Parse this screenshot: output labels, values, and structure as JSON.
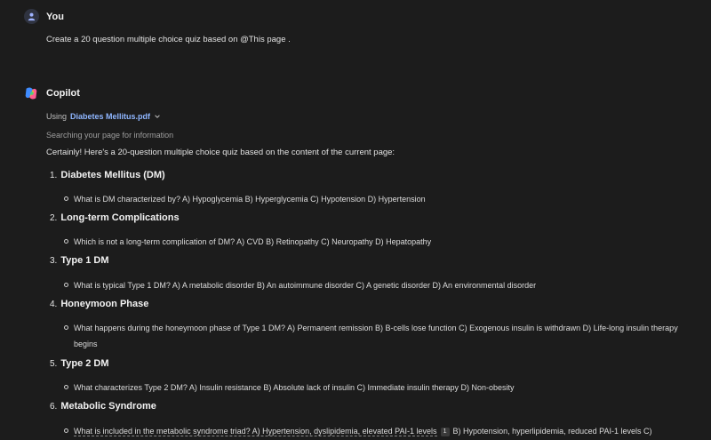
{
  "user": {
    "name": "You",
    "message": "Create a 20 question multiple choice quiz based on @This page ."
  },
  "copilot": {
    "name": "Copilot",
    "using_label": "Using",
    "file_name": "Diabetes Mellitus.pdf",
    "searching": "Searching your page for information",
    "intro": "Certainly! Here's a 20-question multiple choice quiz based on the content of the current page:"
  },
  "sections": [
    {
      "num": "1.",
      "title": "Diabetes Mellitus (DM)",
      "question": "What is DM characterized by? A) Hypoglycemia B) Hyperglycemia C) Hypotension D) Hypertension"
    },
    {
      "num": "2.",
      "title": "Long-term Complications",
      "question": "Which is not a long-term complication of DM? A) CVD B) Retinopathy C) Neuropathy D) Hepatopathy"
    },
    {
      "num": "3.",
      "title": "Type 1 DM",
      "question": "What is typical Type 1 DM? A) A metabolic disorder B) An autoimmune disorder C) A genetic disorder D) An environmental disorder"
    },
    {
      "num": "4.",
      "title": "Honeymoon Phase",
      "question": "What happens during the honeymoon phase of Type 1 DM? A) Permanent remission B) B-cells lose function C) Exogenous insulin is withdrawn D) Life-long insulin therapy begins"
    },
    {
      "num": "5.",
      "title": "Type 2 DM",
      "question": "What characterizes Type 2 DM? A) Insulin resistance B) Absolute lack of insulin C) Immediate insulin therapy D) Non-obesity"
    },
    {
      "num": "6.",
      "title": "Metabolic Syndrome",
      "question_part1": "What is included in the metabolic syndrome triad? A) Hypertension, dyslipidemia, elevated PAI-1 levels",
      "citation": "1",
      "question_part2": "B) Hypotension, hyperlipidemia, reduced PAI-1 levels C)"
    }
  ]
}
